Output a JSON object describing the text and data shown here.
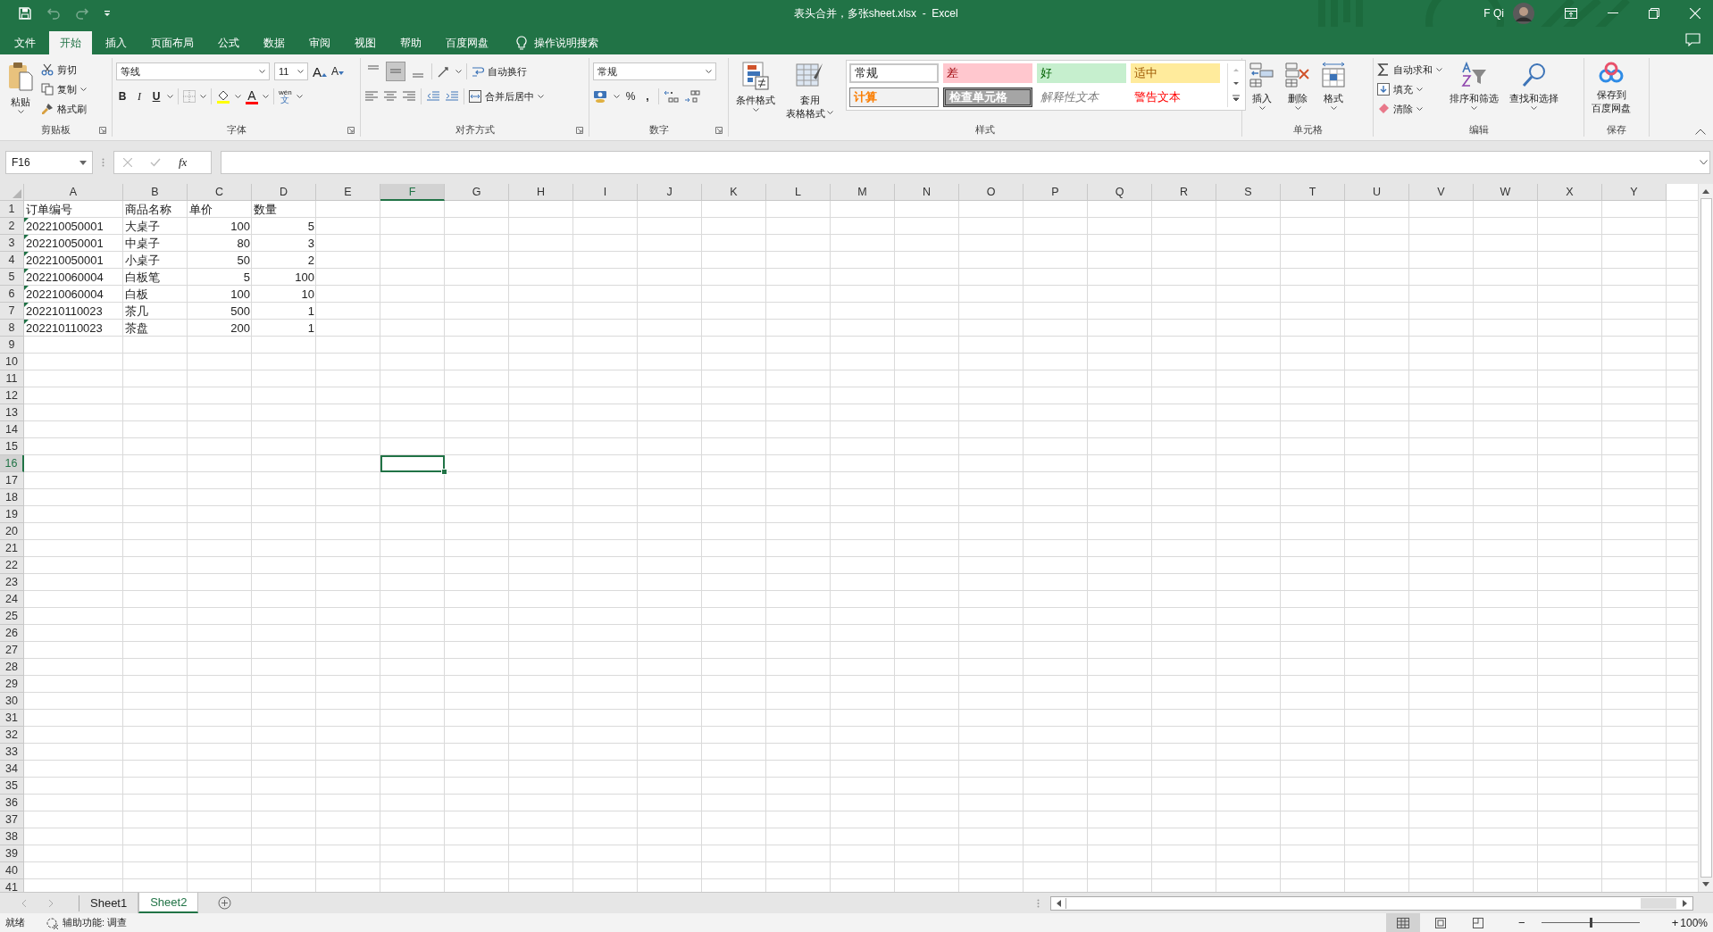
{
  "title_bar": {
    "title": "表头合并，多张sheet.xlsx  -  Excel",
    "user": "F Qi",
    "undo": {
      "disabled": true
    },
    "redo": {
      "disabled": true
    }
  },
  "menu_tabs": [
    {
      "label": "文件",
      "selected": false
    },
    {
      "label": "开始",
      "selected": true
    },
    {
      "label": "插入",
      "selected": false
    },
    {
      "label": "页面布局",
      "selected": false
    },
    {
      "label": "公式",
      "selected": false
    },
    {
      "label": "数据",
      "selected": false
    },
    {
      "label": "审阅",
      "selected": false
    },
    {
      "label": "视图",
      "selected": false
    },
    {
      "label": "帮助",
      "selected": false
    },
    {
      "label": "百度网盘",
      "selected": false
    }
  ],
  "tell_me": {
    "placeholder": "操作说明搜索"
  },
  "ribbon": {
    "clipboard": {
      "label": "剪贴板",
      "paste": "粘贴",
      "cut": "剪切",
      "copy": "复制",
      "format_painter": "格式刷"
    },
    "font": {
      "label": "字体",
      "font_name": "等线",
      "font_size": "11",
      "grow": "A",
      "shrink": "A",
      "bold": "B",
      "italic": "I",
      "underline": "U",
      "font_color": "A",
      "phonetic": [
        "wén",
        "文"
      ]
    },
    "alignment": {
      "label": "对齐方式",
      "wrap": "自动换行",
      "merge": "合并后居中"
    },
    "number": {
      "label": "数字",
      "format": "常规",
      "percent": "%",
      "comma": ","
    },
    "styles": {
      "label": "样式",
      "conditional": "条件格式",
      "table_format": [
        "套用",
        "表格格式"
      ],
      "gallery": [
        {
          "label": "常规",
          "kind": "normal"
        },
        {
          "label": "差",
          "kind": "bad"
        },
        {
          "label": "好",
          "kind": "good"
        },
        {
          "label": "适中",
          "kind": "neutral"
        },
        {
          "label": "计算",
          "kind": "calculation"
        },
        {
          "label": "检查单元格",
          "kind": "check"
        },
        {
          "label": "解释性文本",
          "kind": "explanatory"
        },
        {
          "label": "警告文本",
          "kind": "warning"
        }
      ]
    },
    "cells": {
      "label": "单元格",
      "insert": "插入",
      "delete": "删除",
      "format": "格式"
    },
    "editing": {
      "label": "编辑",
      "autosum": "自动求和",
      "fill": "填充",
      "clear": "清除",
      "sort": "排序和筛选",
      "find": "查找和选择"
    },
    "save": {
      "label": "保存",
      "button": [
        "保存到",
        "百度网盘"
      ]
    }
  },
  "formula_bar": {
    "name_box": "F16",
    "function_label": "fx"
  },
  "sheet": {
    "columns": [
      {
        "label": "A",
        "selected": false
      },
      {
        "label": "B",
        "selected": false
      },
      {
        "label": "C",
        "selected": false
      },
      {
        "label": "D",
        "selected": false
      },
      {
        "label": "E",
        "selected": false
      },
      {
        "label": "F",
        "selected": true
      },
      {
        "label": "G",
        "selected": false
      },
      {
        "label": "H",
        "selected": false
      },
      {
        "label": "I",
        "selected": false
      },
      {
        "label": "J",
        "selected": false
      },
      {
        "label": "K",
        "selected": false
      },
      {
        "label": "L",
        "selected": false
      },
      {
        "label": "M",
        "selected": false
      },
      {
        "label": "N",
        "selected": false
      },
      {
        "label": "O",
        "selected": false
      },
      {
        "label": "P",
        "selected": false
      },
      {
        "label": "Q",
        "selected": false
      },
      {
        "label": "R",
        "selected": false
      },
      {
        "label": "S",
        "selected": false
      },
      {
        "label": "T",
        "selected": false
      },
      {
        "label": "U",
        "selected": false
      },
      {
        "label": "V",
        "selected": false
      },
      {
        "label": "W",
        "selected": false
      },
      {
        "label": "X",
        "selected": false
      },
      {
        "label": "Y",
        "selected": false
      }
    ],
    "rows": [
      {
        "label": "1",
        "selected": false,
        "cells": [
          {
            "value": "订单编号",
            "kind": "text",
            "flag": false
          },
          {
            "value": "商品名称",
            "kind": "text",
            "flag": false
          },
          {
            "value": "单价",
            "kind": "text",
            "flag": false
          },
          {
            "value": "数量",
            "kind": "text",
            "flag": false
          }
        ]
      },
      {
        "label": "2",
        "selected": false,
        "cells": [
          {
            "value": "202210050001",
            "kind": "text",
            "flag": true
          },
          {
            "value": "大桌子",
            "kind": "text",
            "flag": false
          },
          {
            "value": "100",
            "kind": "number",
            "flag": false
          },
          {
            "value": "5",
            "kind": "number",
            "flag": false
          }
        ]
      },
      {
        "label": "3",
        "selected": false,
        "cells": [
          {
            "value": "202210050001",
            "kind": "text",
            "flag": true
          },
          {
            "value": "中桌子",
            "kind": "text",
            "flag": false
          },
          {
            "value": "80",
            "kind": "number",
            "flag": false
          },
          {
            "value": "3",
            "kind": "number",
            "flag": false
          }
        ]
      },
      {
        "label": "4",
        "selected": false,
        "cells": [
          {
            "value": "202210050001",
            "kind": "text",
            "flag": true
          },
          {
            "value": "小桌子",
            "kind": "text",
            "flag": false
          },
          {
            "value": "50",
            "kind": "number",
            "flag": false
          },
          {
            "value": "2",
            "kind": "number",
            "flag": false
          }
        ]
      },
      {
        "label": "5",
        "selected": false,
        "cells": [
          {
            "value": "202210060004",
            "kind": "text",
            "flag": true
          },
          {
            "value": "白板笔",
            "kind": "text",
            "flag": false
          },
          {
            "value": "5",
            "kind": "number",
            "flag": false
          },
          {
            "value": "100",
            "kind": "number",
            "flag": false
          }
        ]
      },
      {
        "label": "6",
        "selected": false,
        "cells": [
          {
            "value": "202210060004",
            "kind": "text",
            "flag": true
          },
          {
            "value": "白板",
            "kind": "text",
            "flag": false
          },
          {
            "value": "100",
            "kind": "number",
            "flag": false
          },
          {
            "value": "10",
            "kind": "number",
            "flag": false
          }
        ]
      },
      {
        "label": "7",
        "selected": false,
        "cells": [
          {
            "value": "202210110023",
            "kind": "text",
            "flag": true
          },
          {
            "value": "茶几",
            "kind": "text",
            "flag": false
          },
          {
            "value": "500",
            "kind": "number",
            "flag": false
          },
          {
            "value": "1",
            "kind": "number",
            "flag": false
          }
        ]
      },
      {
        "label": "8",
        "selected": false,
        "cells": [
          {
            "value": "202210110023",
            "kind": "text",
            "flag": true
          },
          {
            "value": "茶盘",
            "kind": "text",
            "flag": false
          },
          {
            "value": "200",
            "kind": "number",
            "flag": false
          },
          {
            "value": "1",
            "kind": "number",
            "flag": false
          }
        ]
      },
      {
        "label": "9",
        "selected": false
      },
      {
        "label": "10",
        "selected": false
      },
      {
        "label": "11",
        "selected": false
      },
      {
        "label": "12",
        "selected": false
      },
      {
        "label": "13",
        "selected": false
      },
      {
        "label": "14",
        "selected": false
      },
      {
        "label": "15",
        "selected": false
      },
      {
        "label": "16",
        "selected": true
      },
      {
        "label": "17",
        "selected": false
      },
      {
        "label": "18",
        "selected": false
      },
      {
        "label": "19",
        "selected": false
      },
      {
        "label": "20",
        "selected": false
      },
      {
        "label": "21",
        "selected": false
      },
      {
        "label": "22",
        "selected": false
      },
      {
        "label": "23",
        "selected": false
      },
      {
        "label": "24",
        "selected": false
      },
      {
        "label": "25",
        "selected": false
      },
      {
        "label": "26",
        "selected": false
      },
      {
        "label": "27",
        "selected": false
      },
      {
        "label": "28",
        "selected": false
      },
      {
        "label": "29",
        "selected": false
      },
      {
        "label": "30",
        "selected": false
      },
      {
        "label": "31",
        "selected": false
      },
      {
        "label": "32",
        "selected": false
      },
      {
        "label": "33",
        "selected": false
      },
      {
        "label": "34",
        "selected": false
      },
      {
        "label": "35",
        "selected": false
      },
      {
        "label": "36",
        "selected": false
      },
      {
        "label": "37",
        "selected": false
      },
      {
        "label": "38",
        "selected": false
      },
      {
        "label": "39",
        "selected": false
      },
      {
        "label": "40",
        "selected": false
      },
      {
        "label": "41",
        "selected": false
      }
    ]
  },
  "sheet_tabs": [
    {
      "label": "Sheet1",
      "selected": false
    },
    {
      "label": "Sheet2",
      "selected": true
    }
  ],
  "status_bar": {
    "ready": "就绪",
    "accessibility": "辅助功能: 调查",
    "views": [
      {
        "kind": "normal",
        "selected": true
      },
      {
        "kind": "page-layout",
        "selected": false
      },
      {
        "kind": "page-break",
        "selected": false
      }
    ],
    "zoom_minus": "−",
    "zoom_plus": "+",
    "zoom_slider": {
      "level": 0.5
    },
    "zoom": "100%"
  }
}
